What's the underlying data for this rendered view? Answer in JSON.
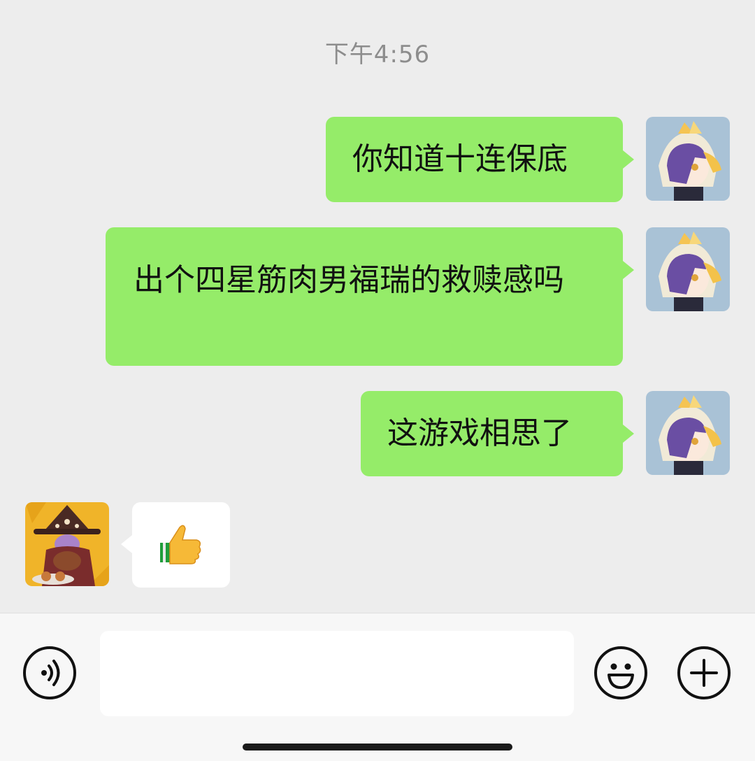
{
  "chat": {
    "timestamp": "下午4:56",
    "messages": [
      {
        "side": "right",
        "text": "你知道十连保底"
      },
      {
        "side": "right",
        "text": "出个四星筋肉男福瑞的救赎感吗"
      },
      {
        "side": "right",
        "text": "这游戏相思了"
      },
      {
        "side": "left",
        "content": "thumbs-up-emoji"
      }
    ]
  },
  "input_bar": {
    "voice_icon": "voice-icon",
    "emoji_icon": "emoji-icon",
    "plus_icon": "plus-icon",
    "text_value": ""
  },
  "colors": {
    "background": "#ededed",
    "sent_bubble": "#95ec69",
    "received_bubble": "#ffffff"
  }
}
